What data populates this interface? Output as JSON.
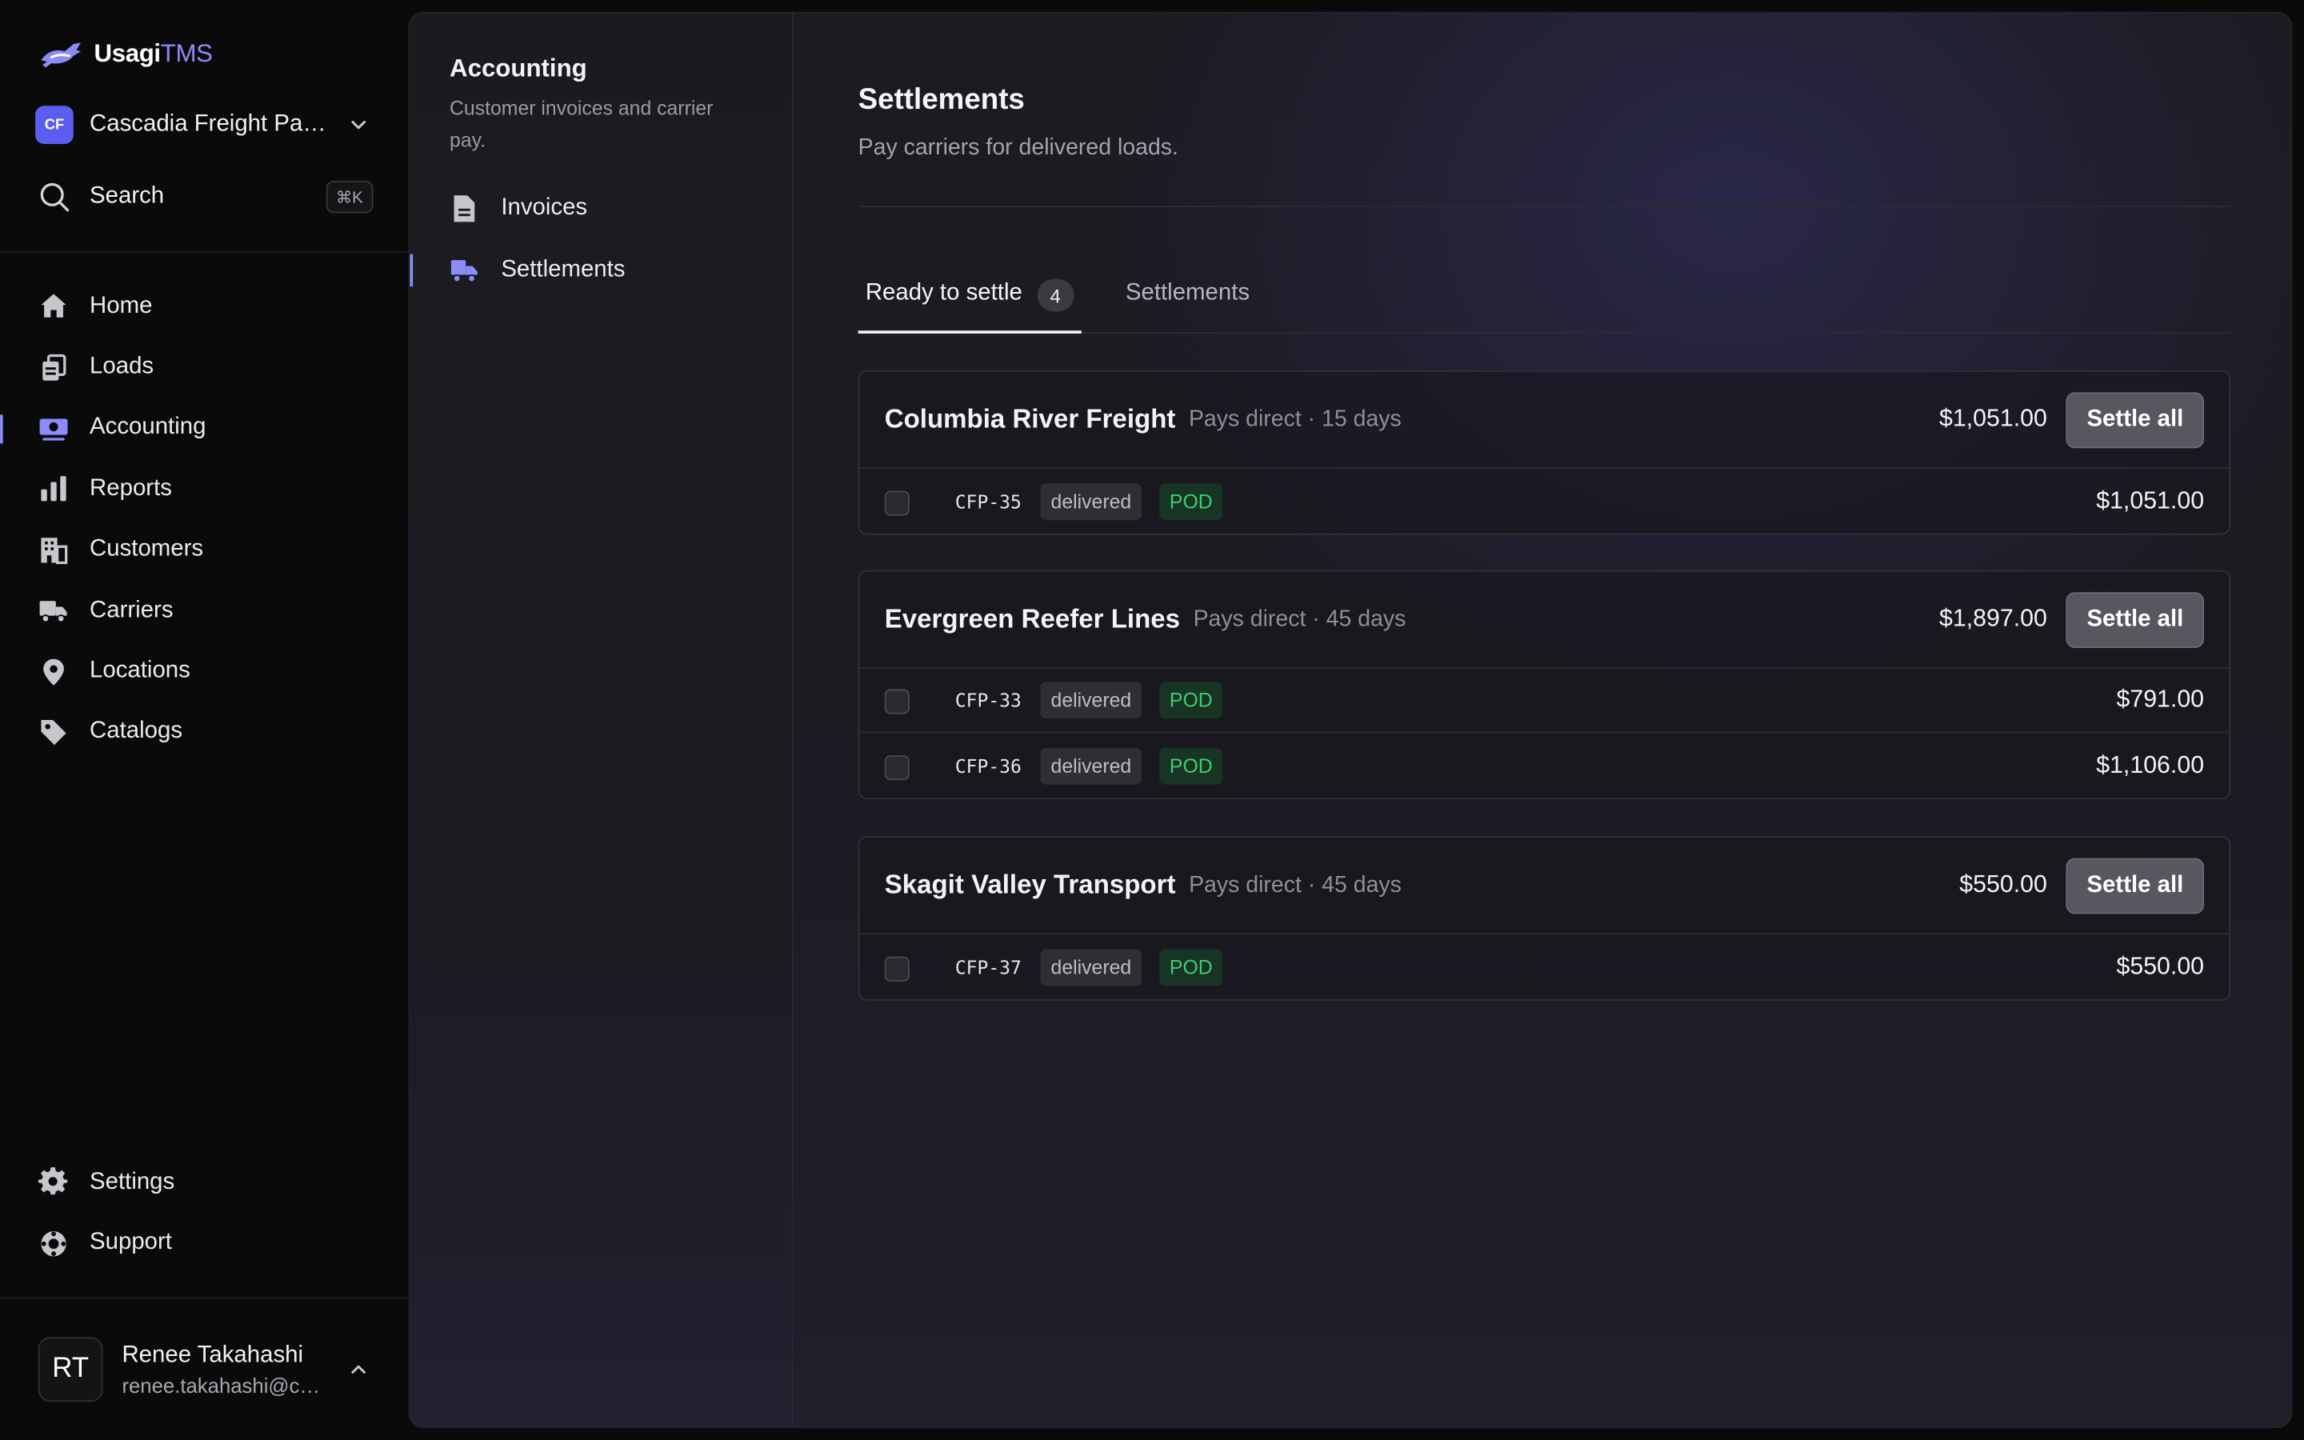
{
  "app": {
    "brand_first": "Usagi",
    "brand_second": "TMS",
    "org_initials": "CF",
    "org_name": "Cascadia Freight Partners",
    "search_label": "Search",
    "search_shortcut": "⌘K"
  },
  "colors": {
    "accent": "#8b8cf8",
    "org_badge": "#5b5df0",
    "pod_green": "#3ecf6e"
  },
  "nav": {
    "items": [
      {
        "label": "Home",
        "icon": "home-icon"
      },
      {
        "label": "Loads",
        "icon": "loads-icon"
      },
      {
        "label": "Accounting",
        "icon": "accounting-icon",
        "active": true
      },
      {
        "label": "Reports",
        "icon": "bar-chart-icon"
      },
      {
        "label": "Customers",
        "icon": "building-icon"
      },
      {
        "label": "Carriers",
        "icon": "truck-icon"
      },
      {
        "label": "Locations",
        "icon": "map-pin-icon"
      },
      {
        "label": "Catalogs",
        "icon": "tag-icon"
      }
    ],
    "bottom": [
      {
        "label": "Settings",
        "icon": "gear-icon"
      },
      {
        "label": "Support",
        "icon": "lifebuoy-icon"
      }
    ]
  },
  "user": {
    "initials": "RT",
    "name": "Renee Takahashi",
    "email": "renee.takahashi@cascadiafreight.com"
  },
  "subnav": {
    "title": "Accounting",
    "description": "Customer invoices and carrier pay.",
    "items": [
      {
        "label": "Invoices",
        "icon": "document-icon"
      },
      {
        "label": "Settlements",
        "icon": "truck-icon",
        "active": true
      }
    ]
  },
  "main": {
    "title": "Settlements",
    "subtitle": "Pay carriers for delivered loads.",
    "tabs": [
      {
        "label": "Ready to settle",
        "count": "4",
        "active": true
      },
      {
        "label": "Settlements"
      }
    ],
    "settle_label": "Settle all",
    "groups": [
      {
        "carrier": "Columbia River Freight",
        "terms": "Pays direct · 15 days",
        "total": "$1,051.00",
        "loads": [
          {
            "id": "CFP-35",
            "status": "delivered",
            "doc": "POD",
            "amount": "$1,051.00"
          }
        ]
      },
      {
        "carrier": "Evergreen Reefer Lines",
        "terms": "Pays direct · 45 days",
        "total": "$1,897.00",
        "loads": [
          {
            "id": "CFP-33",
            "status": "delivered",
            "doc": "POD",
            "amount": "$791.00"
          },
          {
            "id": "CFP-36",
            "status": "delivered",
            "doc": "POD",
            "amount": "$1,106.00"
          }
        ]
      },
      {
        "carrier": "Skagit Valley Transport",
        "terms": "Pays direct · 45 days",
        "total": "$550.00",
        "loads": [
          {
            "id": "CFP-37",
            "status": "delivered",
            "doc": "POD",
            "amount": "$550.00"
          }
        ]
      }
    ]
  }
}
